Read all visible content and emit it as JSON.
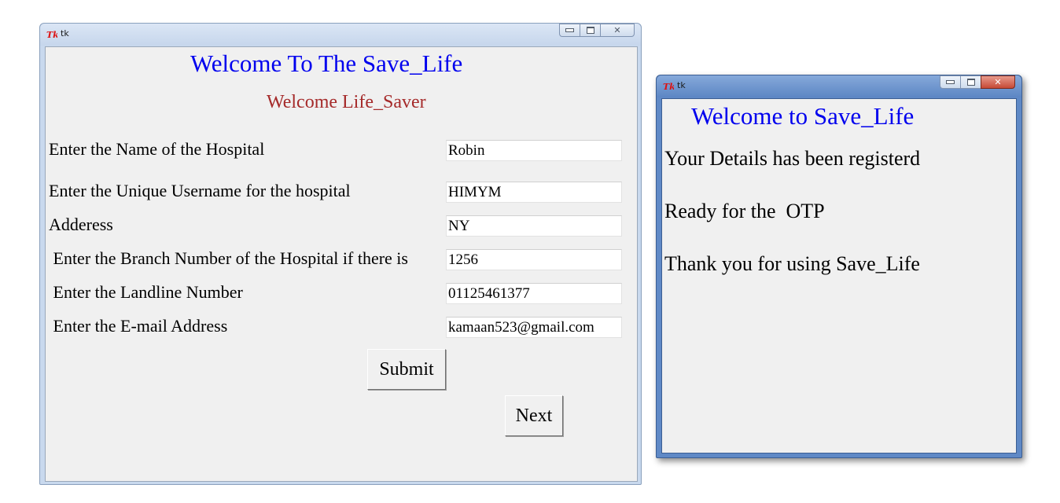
{
  "registration_window": {
    "title": "tk",
    "heading": "Welcome To The Save_Life",
    "subheading": "Welcome Life_Saver",
    "fields": [
      {
        "label": "Enter the Name of the Hospital",
        "value": "Robin"
      },
      {
        "label": "Enter the Unique Username for the hospital",
        "value": "HIMYM"
      },
      {
        "label": "Adderess",
        "value": "NY"
      },
      {
        "label": " Enter the Branch Number of the Hospital if there is",
        "value": "1256"
      },
      {
        "label": " Enter the Landline Number",
        "value": "01125461377"
      },
      {
        "label": " Enter the E-mail Address",
        "value": "kamaan523@gmail.com"
      }
    ],
    "submit_label": "Submit",
    "next_label": "Next"
  },
  "confirmation_window": {
    "title": "tk",
    "heading": "Welcome to Save_Life",
    "lines": [
      "Your Details has been registerd",
      "Ready for the  OTP",
      "Thank you for using Save_Life"
    ]
  },
  "colors": {
    "heading": "#0000ee",
    "subheading": "#a52a2a",
    "client_bg": "#f0f0f0"
  }
}
